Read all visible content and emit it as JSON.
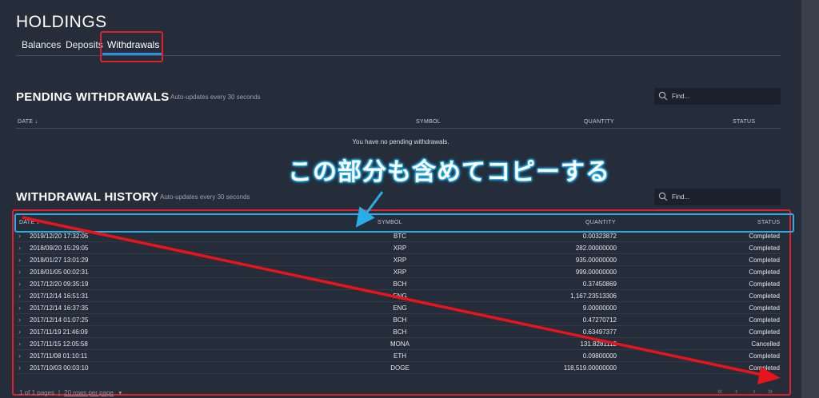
{
  "page": {
    "title": "HOLDINGS"
  },
  "tabs": [
    {
      "label": "Balances"
    },
    {
      "label": "Deposits"
    },
    {
      "label": "Withdrawals",
      "active": true
    }
  ],
  "pending": {
    "title": "PENDING WITHDRAWALS",
    "subtitle": "Auto-updates every 30 seconds",
    "search_placeholder": "Find...",
    "columns": {
      "date": "DATE",
      "symbol": "SYMBOL",
      "quantity": "QUANTITY",
      "status": "STATUS"
    },
    "empty_message": "You have no pending withdrawals."
  },
  "annotation": {
    "text": "この部分も含めてコピーする",
    "color": "#27aee6"
  },
  "history": {
    "title": "WITHDRAWAL HISTORY",
    "subtitle": "Auto-updates every 30 seconds",
    "search_placeholder": "Find...",
    "columns": {
      "date": "DATE",
      "symbol": "SYMBOL",
      "quantity": "QUANTITY",
      "status": "STATUS"
    },
    "rows": [
      {
        "date": "2019/12/20 17:32:05",
        "symbol": "BTC",
        "quantity": "0.00323872",
        "status": "Completed"
      },
      {
        "date": "2018/09/20 15:29:05",
        "symbol": "XRP",
        "quantity": "282.00000000",
        "status": "Completed"
      },
      {
        "date": "2018/01/27 13:01:29",
        "symbol": "XRP",
        "quantity": "935.00000000",
        "status": "Completed"
      },
      {
        "date": "2018/01/05 00:02:31",
        "symbol": "XRP",
        "quantity": "999.00000000",
        "status": "Completed"
      },
      {
        "date": "2017/12/20 09:35:19",
        "symbol": "BCH",
        "quantity": "0.37450869",
        "status": "Completed"
      },
      {
        "date": "2017/12/14 16:51:31",
        "symbol": "ENG",
        "quantity": "1,167.23513306",
        "status": "Completed"
      },
      {
        "date": "2017/12/14 16:37:35",
        "symbol": "ENG",
        "quantity": "9.00000000",
        "status": "Completed"
      },
      {
        "date": "2017/12/14 01:07:25",
        "symbol": "BCH",
        "quantity": "0.47270712",
        "status": "Completed"
      },
      {
        "date": "2017/11/19 21:46:09",
        "symbol": "BCH",
        "quantity": "0.63497377",
        "status": "Completed"
      },
      {
        "date": "2017/11/15 12:05:58",
        "symbol": "MONA",
        "quantity": "131.8281112",
        "status": "Cancelled"
      },
      {
        "date": "2017/11/08 01:10:11",
        "symbol": "ETH",
        "quantity": "0.09800000",
        "status": "Completed"
      },
      {
        "date": "2017/10/03 00:03:10",
        "symbol": "DOGE",
        "quantity": "118,519.00000000",
        "status": "Completed"
      }
    ]
  },
  "pagination": {
    "page_info": "1 of 1 pages",
    "separator": "|",
    "rows_per_page": "20 rows per page"
  },
  "icons": {
    "sort": "↓",
    "chevron": "›",
    "first": "«",
    "prev": "‹",
    "next": "›",
    "last": "»",
    "dropdown": "▾"
  },
  "colors": {
    "highlight_red": "#e0202a",
    "highlight_blue": "#27aee6",
    "tab_accent": "#2f8ee0"
  }
}
